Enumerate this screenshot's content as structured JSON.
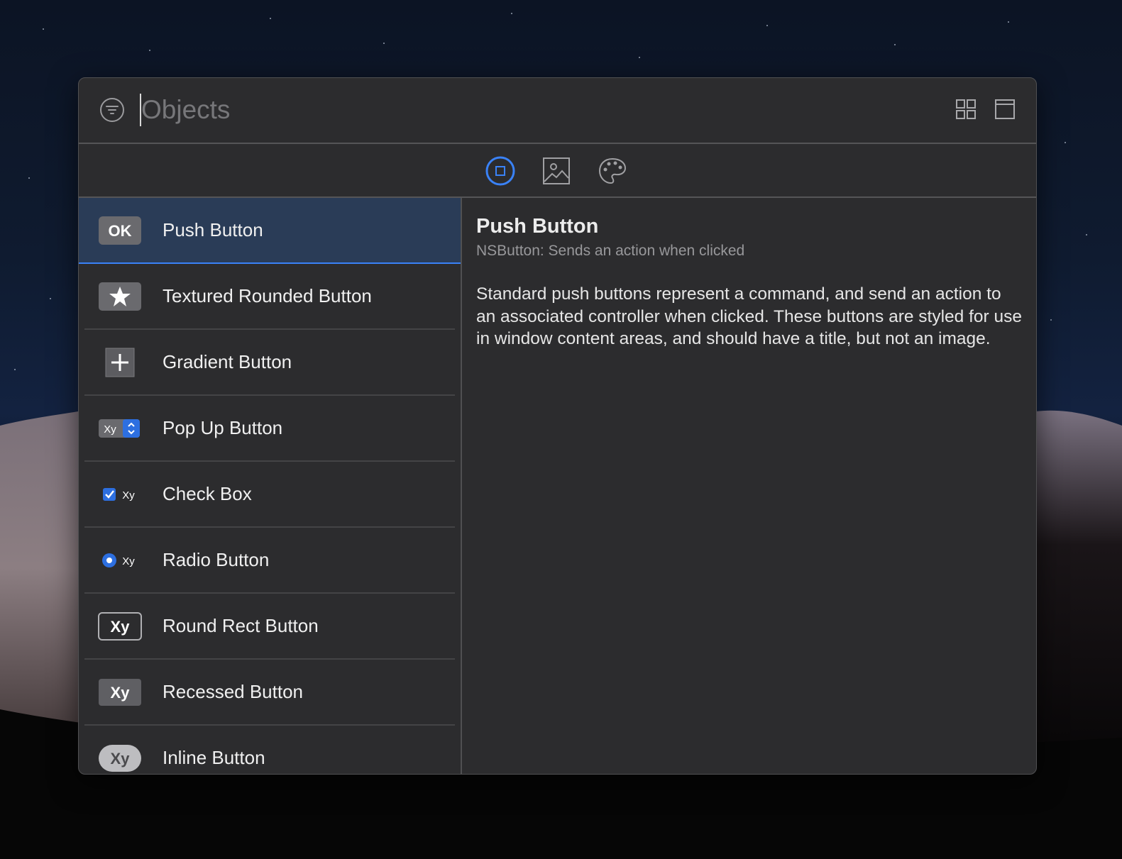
{
  "search": {
    "placeholder": "Objects",
    "value": ""
  },
  "toolbar": {
    "segments": [
      {
        "icon": "objects-icon",
        "selected": true
      },
      {
        "icon": "media-icon",
        "selected": false
      },
      {
        "icon": "colors-palette-icon",
        "selected": false
      }
    ]
  },
  "view_controls": {
    "grid": "grid-view-icon",
    "window": "window-icon"
  },
  "objects": [
    {
      "label": "Push Button",
      "thumb_text": "OK"
    },
    {
      "label": "Textured Rounded Button",
      "thumb_icon": "star-icon"
    },
    {
      "label": "Gradient Button",
      "thumb_icon": "plus-icon"
    },
    {
      "label": "Pop Up Button",
      "thumb_text": "Xy"
    },
    {
      "label": "Check Box",
      "thumb_text": "Xy"
    },
    {
      "label": "Radio Button",
      "thumb_text": "Xy"
    },
    {
      "label": "Round Rect Button",
      "thumb_text": "Xy"
    },
    {
      "label": "Recessed Button",
      "thumb_text": "Xy"
    },
    {
      "label": "Inline Button",
      "thumb_text": "Xy"
    }
  ],
  "selected_index": 0,
  "detail": {
    "title": "Push Button",
    "subtitle": "NSButton: Sends an action when clicked",
    "description": "Standard push buttons represent a command, and send an action to an associated controller when clicked. These buttons are styled for use in window content areas, and should have a title, but not an image."
  },
  "colors": {
    "accent": "#3a82f7",
    "selection": "#2a3c57",
    "panel": "#2c2c2e"
  }
}
